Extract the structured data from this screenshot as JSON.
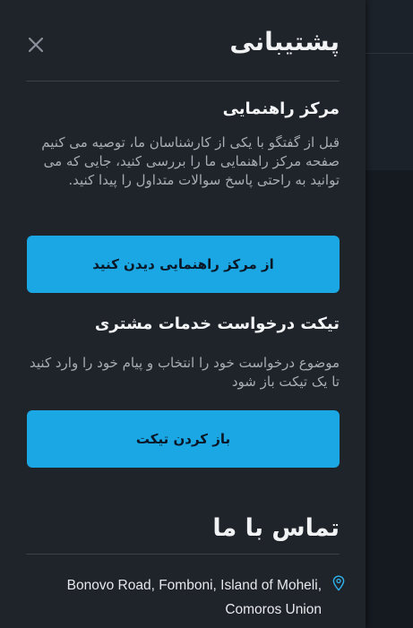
{
  "panel": {
    "title": "پشتیبانی",
    "close_icon": "close-icon"
  },
  "help_center": {
    "title": "مرکز راهنمایی",
    "description": "قبل از گفتگو با یکی از کارشناسان ما، توصیه می کنیم صفحه مرکز راهنمایی ما را بررسی کنید، جایی که می توانید به راحتی پاسخ سوالات متداول را پیدا کنید.",
    "button_label": "از مرکز راهنمایی دیدن کنید"
  },
  "ticket": {
    "title": "تیکت درخواست خدمات مشتری",
    "description": "موضوع درخواست خود را انتخاب و پیام خود را وارد کنید تا یک تیکت باز شود",
    "button_label": "باز کردن تیکت"
  },
  "contact": {
    "title": "تماس با ما",
    "address": "Bonovo Road, Fomboni, Island of Moheli, Comoros Union",
    "address_icon": "map-pin-icon"
  },
  "colors": {
    "panel_bg": "#1f232a",
    "accent": "#1ba7e3",
    "text_primary": "#f1f2f4",
    "text_secondary": "#a8adb5"
  }
}
